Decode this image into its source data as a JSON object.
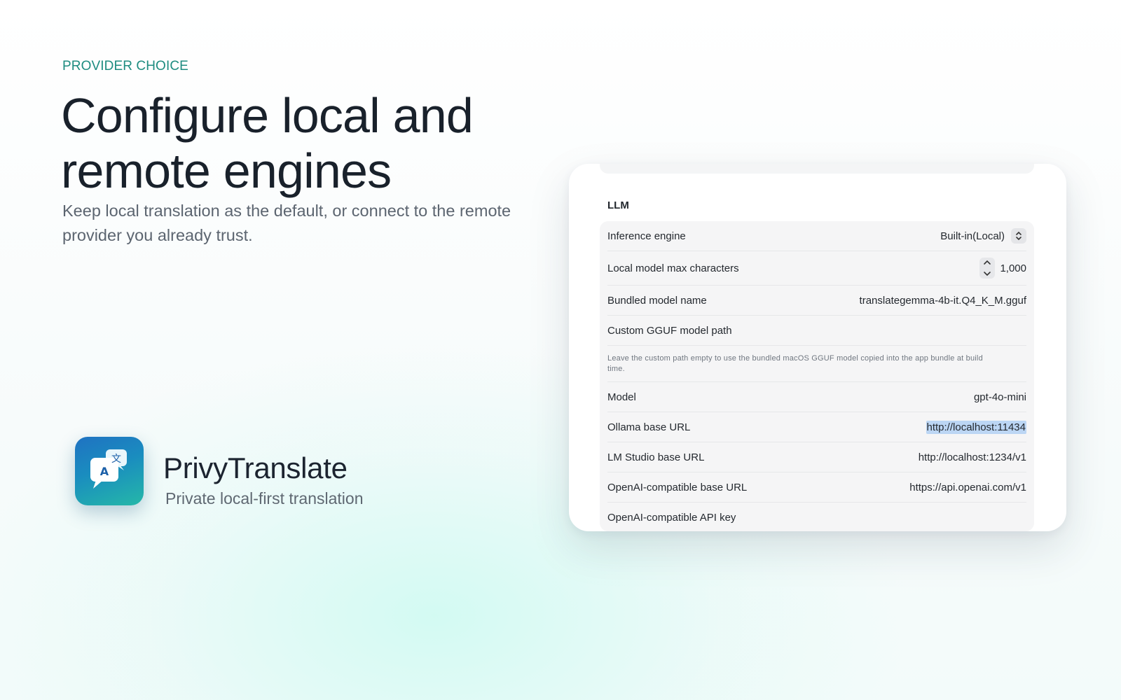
{
  "hero": {
    "eyebrow": "PROVIDER CHOICE",
    "headline_line1": "Configure local and",
    "headline_line2": "remote engines",
    "subline": "Keep local translation as the default, or connect to the remote provider you already trust."
  },
  "brand": {
    "name": "PrivyTranslate",
    "tagline": "Private local-first translation",
    "icon_glyph_top": "文",
    "icon_glyph_bottom": "A"
  },
  "settings": {
    "section_title": "LLM",
    "inference_engine": {
      "label": "Inference engine",
      "value": "Built-in(Local)"
    },
    "local_max_chars": {
      "label": "Local model max characters",
      "value": "1,000"
    },
    "bundled_model": {
      "label": "Bundled model name",
      "value": "translategemma-4b-it.Q4_K_M.gguf"
    },
    "custom_gguf": {
      "label": "Custom GGUF model path",
      "value": ""
    },
    "note": "Leave the custom path empty to use the bundled macOS GGUF model copied into the app bundle at build time.",
    "model": {
      "label": "Model",
      "value": "gpt-4o-mini"
    },
    "ollama_url": {
      "label": "Ollama base URL",
      "value": "http://localhost:11434"
    },
    "lmstudio_url": {
      "label": "LM Studio base URL",
      "value": "http://localhost:1234/v1"
    },
    "openai_url": {
      "label": "OpenAI-compatible base URL",
      "value": "https://api.openai.com/v1"
    },
    "openai_key": {
      "label": "OpenAI-compatible API key",
      "value": ""
    }
  },
  "colors": {
    "accent": "#1e8c80",
    "selection": "#bcd6f4",
    "icon_gradient_start": "#1f72c2",
    "icon_gradient_end": "#25b8a8"
  }
}
